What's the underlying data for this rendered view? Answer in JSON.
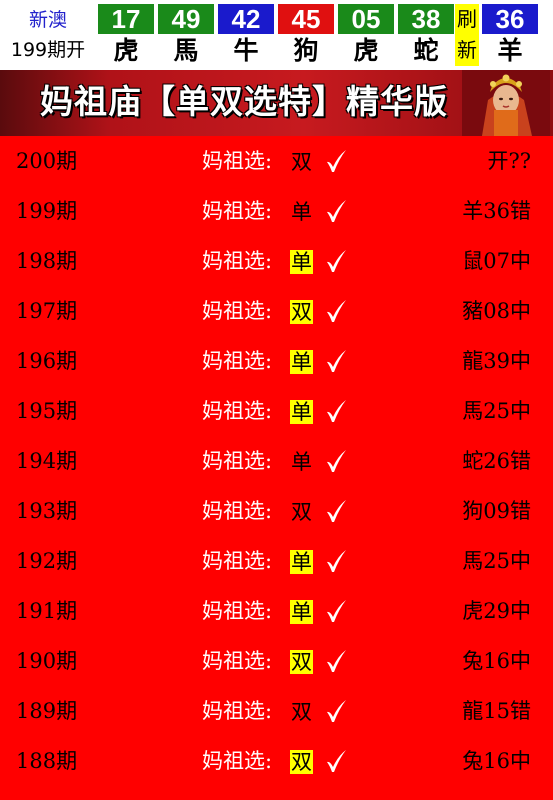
{
  "header": {
    "brand_line1": "新澳",
    "brand_line2": "199期开",
    "refresh_label": "刷新",
    "balls": [
      {
        "number": "17",
        "zodiac": "虎",
        "color": "#1a8a1a"
      },
      {
        "number": "49",
        "zodiac": "馬",
        "color": "#1a8a1a"
      },
      {
        "number": "42",
        "zodiac": "牛",
        "color": "#1a1acc"
      },
      {
        "number": "45",
        "zodiac": "狗",
        "color": "#e01010"
      },
      {
        "number": "05",
        "zodiac": "虎",
        "color": "#1a8a1a"
      },
      {
        "number": "38",
        "zodiac": "蛇",
        "color": "#1a8a1a"
      },
      {
        "number": "36",
        "zodiac": "羊",
        "color": "#1a1acc"
      }
    ]
  },
  "banner": {
    "title": "妈祖庙【单双选特】精华版"
  },
  "pick_prefix": "妈祖选:",
  "rows": [
    {
      "period": "200期",
      "pick": "双",
      "highlight": false,
      "result": "开??"
    },
    {
      "period": "199期",
      "pick": "单",
      "highlight": false,
      "result": "羊36错"
    },
    {
      "period": "198期",
      "pick": "单",
      "highlight": true,
      "result": "鼠07中"
    },
    {
      "period": "197期",
      "pick": "双",
      "highlight": true,
      "result": "豬08中"
    },
    {
      "period": "196期",
      "pick": "单",
      "highlight": true,
      "result": "龍39中"
    },
    {
      "period": "195期",
      "pick": "单",
      "highlight": true,
      "result": "馬25中"
    },
    {
      "period": "194期",
      "pick": "单",
      "highlight": false,
      "result": "蛇26错"
    },
    {
      "period": "193期",
      "pick": "双",
      "highlight": false,
      "result": "狗09错"
    },
    {
      "period": "192期",
      "pick": "单",
      "highlight": true,
      "result": "馬25中"
    },
    {
      "period": "191期",
      "pick": "单",
      "highlight": true,
      "result": "虎29中"
    },
    {
      "period": "190期",
      "pick": "双",
      "highlight": true,
      "result": "兔16中"
    },
    {
      "period": "189期",
      "pick": "双",
      "highlight": false,
      "result": "龍15错"
    },
    {
      "period": "188期",
      "pick": "双",
      "highlight": true,
      "result": "兔16中"
    }
  ],
  "colors": {
    "page_background": "#ff0000",
    "highlight": "#ffff00",
    "refresh_background": "#ffff00"
  }
}
